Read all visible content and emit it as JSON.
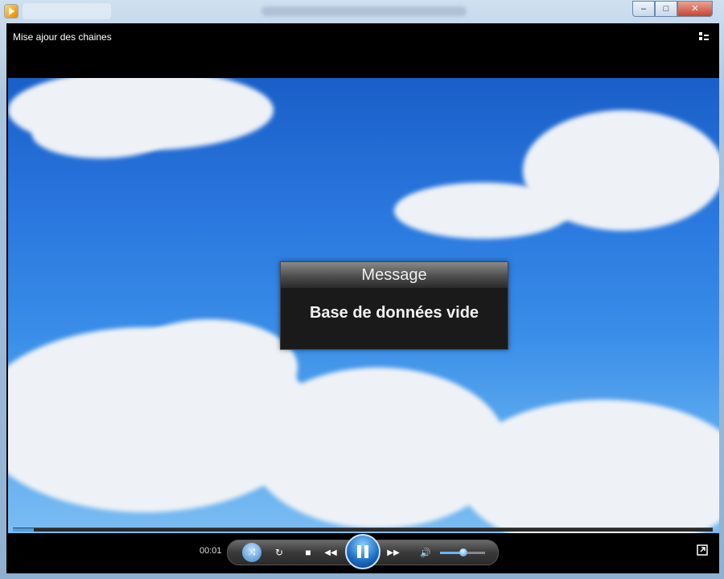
{
  "window": {
    "controls": {
      "minimize_label": "‒",
      "maximize_label": "□",
      "close_label": "✕"
    }
  },
  "player": {
    "media_title": "Mise ajour des chaines",
    "time": "00:01",
    "seek_progress_pct": 3,
    "volume_pct": 55,
    "osd": {
      "title": "Message",
      "text": "Base de données vide"
    },
    "controls": {
      "shuffle_label": "⤨",
      "repeat_label": "↻",
      "stop_label": "■",
      "prev_label": "◀◀",
      "next_label": "▶▶",
      "volume_label": "🔊"
    },
    "colors": {
      "accent": "#4fa0e0",
      "sky": "#2a78df",
      "osd_bg": "#1a1a1a"
    }
  }
}
